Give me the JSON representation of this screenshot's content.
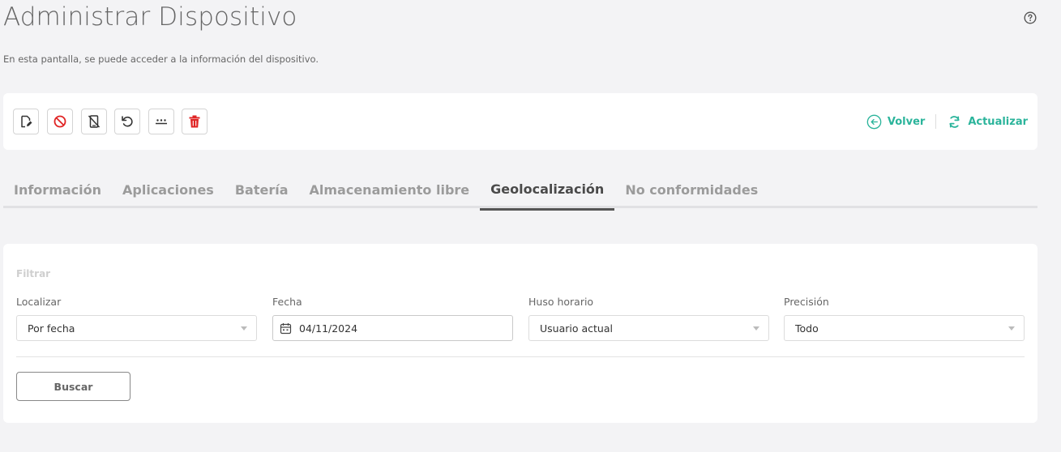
{
  "header": {
    "title": "Administrar Dispositivo",
    "subtitle": "En esta pantalla, se puede acceder a la información del dispositivo.",
    "help_icon": "help-circle-icon"
  },
  "toolbar": {
    "buttons": [
      {
        "name": "edit-device-button",
        "icon": "edit-document-icon",
        "color": "#333333"
      },
      {
        "name": "block-button",
        "icon": "block-icon",
        "color": "#e02424"
      },
      {
        "name": "disable-device-button",
        "icon": "device-off-icon",
        "color": "#333333"
      },
      {
        "name": "reset-button",
        "icon": "rotate-ccw-icon",
        "color": "#333333"
      },
      {
        "name": "password-button",
        "icon": "password-icon",
        "color": "#333333"
      },
      {
        "name": "delete-button",
        "icon": "trash-icon",
        "color": "#e02424"
      }
    ],
    "back_label": "Volver",
    "refresh_label": "Actualizar",
    "accent_color": "#2bb49b"
  },
  "tabs": [
    {
      "label": "Información",
      "active": false
    },
    {
      "label": "Aplicaciones",
      "active": false
    },
    {
      "label": "Batería",
      "active": false
    },
    {
      "label": "Almacenamiento libre",
      "active": false
    },
    {
      "label": "Geolocalización",
      "active": true
    },
    {
      "label": "No conformidades",
      "active": false
    }
  ],
  "filter": {
    "heading": "Filtrar",
    "localizar": {
      "label": "Localizar",
      "value": "Por fecha"
    },
    "fecha": {
      "label": "Fecha",
      "value": "04/11/2024"
    },
    "huso": {
      "label": "Huso horario",
      "value": "Usuario actual"
    },
    "precision": {
      "label": "Precisión",
      "value": "Todo"
    },
    "search_label": "Buscar"
  }
}
